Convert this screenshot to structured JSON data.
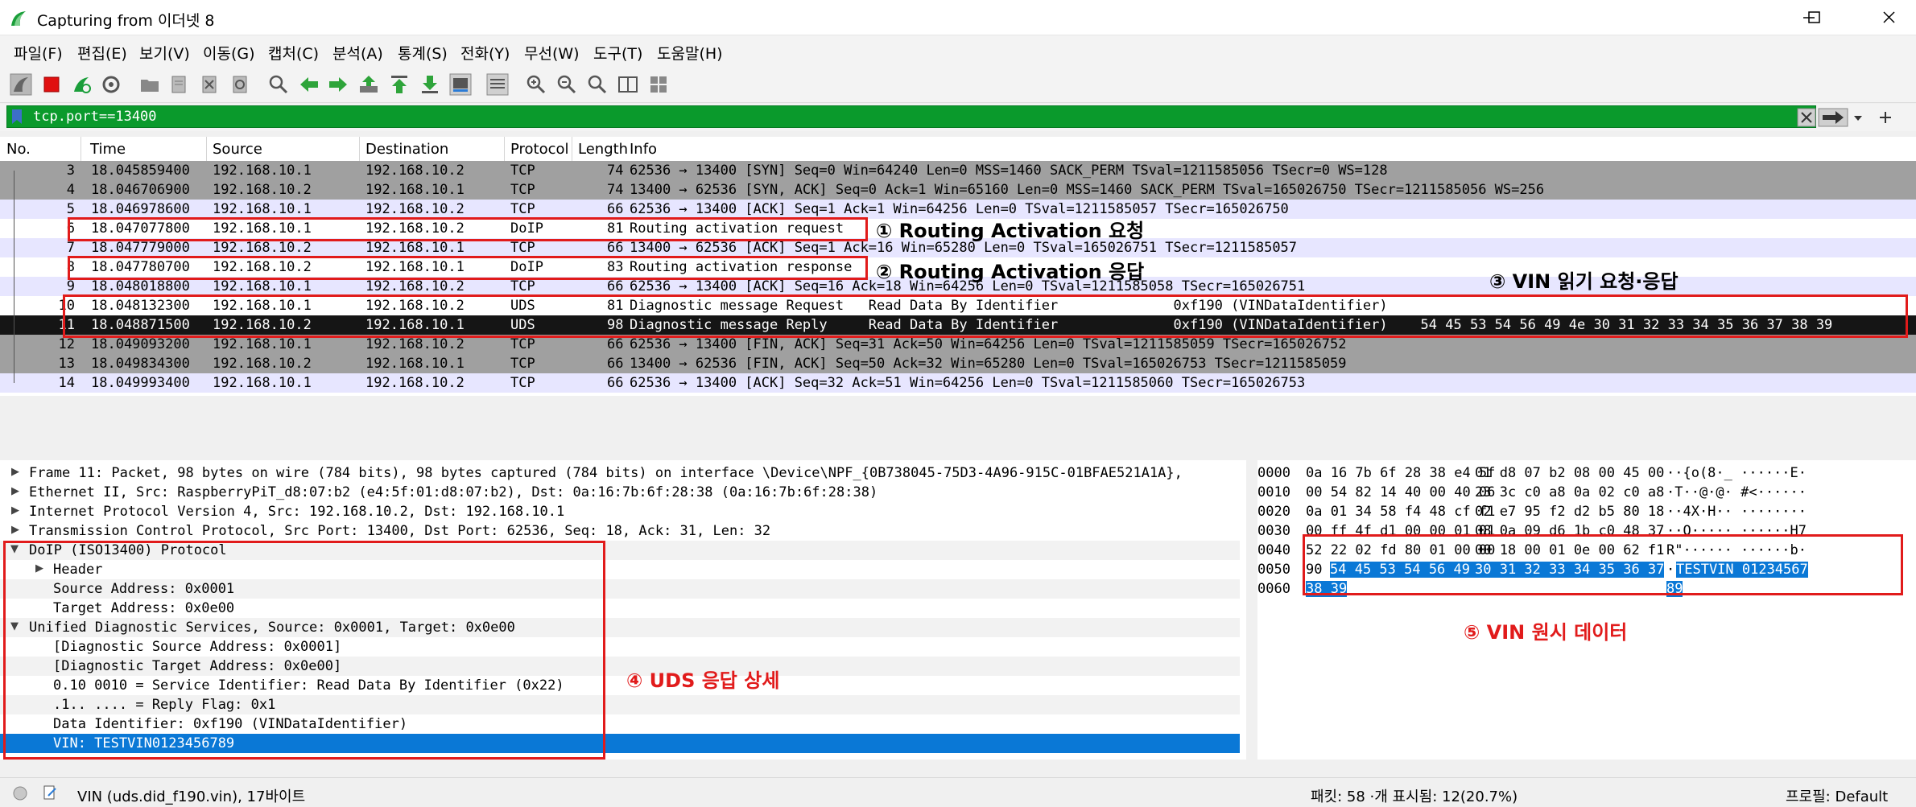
{
  "window": {
    "title": "Capturing from 이더넷 8"
  },
  "menu": [
    "파일(F)",
    "편집(E)",
    "보기(V)",
    "이동(G)",
    "캡처(C)",
    "분석(A)",
    "통계(S)",
    "전화(Y)",
    "무선(W)",
    "도구(T)",
    "도움말(H)"
  ],
  "filter": {
    "value": "tcp.port==13400"
  },
  "packet_list": {
    "columns": [
      "No.",
      "Time",
      "Source",
      "Destination",
      "Protocol",
      "Length",
      "Info"
    ],
    "rows": [
      {
        "no": "3",
        "time": "18.045859400",
        "src": "192.168.10.1",
        "dst": "192.168.10.2",
        "proto": "TCP",
        "len": "74",
        "info": "62536 → 13400 [SYN] Seq=0 Win=64240 Len=0 MSS=1460 SACK_PERM TSval=1211585056 TSecr=0 WS=128"
      },
      {
        "no": "4",
        "time": "18.046706900",
        "src": "192.168.10.2",
        "dst": "192.168.10.1",
        "proto": "TCP",
        "len": "74",
        "info": "13400 → 62536 [SYN, ACK] Seq=0 Ack=1 Win=65160 Len=0 MSS=1460 SACK_PERM TSval=165026750 TSecr=1211585056 WS=256"
      },
      {
        "no": "5",
        "time": "18.046978600",
        "src": "192.168.10.1",
        "dst": "192.168.10.2",
        "proto": "TCP",
        "len": "66",
        "info": "62536 → 13400 [ACK] Seq=1 Ack=1 Win=64256 Len=0 TSval=1211585057 TSecr=165026750"
      },
      {
        "no": "6",
        "time": "18.047077800",
        "src": "192.168.10.1",
        "dst": "192.168.10.2",
        "proto": "DoIP",
        "len": "81",
        "info": "Routing activation request"
      },
      {
        "no": "7",
        "time": "18.047779000",
        "src": "192.168.10.2",
        "dst": "192.168.10.1",
        "proto": "TCP",
        "len": "66",
        "info": "13400 → 62536 [ACK] Seq=1 Ack=16 Win=65280 Len=0 TSval=165026751 TSecr=1211585057"
      },
      {
        "no": "8",
        "time": "18.047780700",
        "src": "192.168.10.2",
        "dst": "192.168.10.1",
        "proto": "DoIP",
        "len": "83",
        "info": "Routing activation response"
      },
      {
        "no": "9",
        "time": "18.048018800",
        "src": "192.168.10.1",
        "dst": "192.168.10.2",
        "proto": "TCP",
        "len": "66",
        "info": "62536 → 13400 [ACK] Seq=16 Ack=18 Win=64256 Len=0 TSval=1211585058 TSecr=165026751"
      },
      {
        "no": "10",
        "time": "18.048132300",
        "src": "192.168.10.1",
        "dst": "192.168.10.2",
        "proto": "UDS",
        "len": "81",
        "info": "Diagnostic message Request   Read Data By Identifier              0xf190 (VINDataIdentifier)"
      },
      {
        "no": "11",
        "time": "18.048871500",
        "src": "192.168.10.2",
        "dst": "192.168.10.1",
        "proto": "UDS",
        "len": "98",
        "info": "Diagnostic message Reply     Read Data By Identifier              0xf190 (VINDataIdentifier)    54 45 53 54 56 49 4e 30 31 32 33 34 35 36 37 38 39"
      },
      {
        "no": "12",
        "time": "18.049093200",
        "src": "192.168.10.1",
        "dst": "192.168.10.2",
        "proto": "TCP",
        "len": "66",
        "info": "62536 → 13400 [FIN, ACK] Seq=31 Ack=50 Win=64256 Len=0 TSval=1211585059 TSecr=165026752"
      },
      {
        "no": "13",
        "time": "18.049834300",
        "src": "192.168.10.2",
        "dst": "192.168.10.1",
        "proto": "TCP",
        "len": "66",
        "info": "13400 → 62536 [FIN, ACK] Seq=50 Ack=32 Win=65280 Len=0 TSval=165026753 TSecr=1211585059"
      },
      {
        "no": "14",
        "time": "18.049993400",
        "src": "192.168.10.1",
        "dst": "192.168.10.2",
        "proto": "TCP",
        "len": "66",
        "info": "62536 → 13400 [ACK] Seq=32 Ack=51 Win=64256 Len=0 TSval=1211585060 TSecr=165026753"
      }
    ]
  },
  "details": [
    "Frame 11: Packet, 98 bytes on wire (784 bits), 98 bytes captured (784 bits) on interface \\Device\\NPF_{0B738045-75D3-4A96-915C-01BFAE521A1A},",
    "Ethernet II, Src: RaspberryPiT_d8:07:b2 (e4:5f:01:d8:07:b2), Dst: 0a:16:7b:6f:28:38 (0a:16:7b:6f:28:38)",
    "Internet Protocol Version 4, Src: 192.168.10.2, Dst: 192.168.10.1",
    "Transmission Control Protocol, Src Port: 13400, Dst Port: 62536, Seq: 18, Ack: 31, Len: 32",
    "DoIP (ISO13400) Protocol",
    "Header",
    "Source Address: 0x0001",
    "Target Address: 0x0e00",
    "Unified Diagnostic Services, Source: 0x0001, Target: 0x0e00",
    "[Diagnostic Source Address: 0x0001]",
    "[Diagnostic Target Address: 0x0e00]",
    "0.10 0010 = Service Identifier: Read Data By Identifier (0x22)",
    ".1.. .... = Reply Flag: 0x1",
    "Data Identifier: 0xf190 (VINDataIdentifier)",
    "VIN: TESTVIN0123456789"
  ],
  "bytes": [
    {
      "off": "0000",
      "hex1": "0a 16 7b 6f 28 38 e4 5f",
      "hex2": "01 d8 07 b2 08 00 45 00",
      "ascii": "··{o(8·_ ······E·"
    },
    {
      "off": "0010",
      "hex1": "00 54 82 14 40 00 40 06",
      "hex2": "23 3c c0 a8 0a 02 c0 a8",
      "ascii": "·T··@·@· #<······"
    },
    {
      "off": "0020",
      "hex1": "0a 01 34 58 f4 48 cf f1",
      "hex2": "02 e7 95 f2 d2 b5 80 18",
      "ascii": "··4X·H·· ········"
    },
    {
      "off": "0030",
      "hex1": "00 ff 4f d1 00 00 01 01",
      "hex2": "08 0a 09 d6 1b c0 48 37",
      "ascii": "··O····· ······H7"
    },
    {
      "off": "0040",
      "hex1": "52 22 02 fd 80 01 00 00",
      "hex2": "00 18 00 01 0e 00 62 f1",
      "ascii": "R\"······ ······b·"
    },
    {
      "off": "0050",
      "hex1a": "90 ",
      "hex1b": "54 45 53 54 56 49 4e",
      "hex2": "30 31 32 33 34 35 36 37",
      "asciia": "·",
      "asciib": "TESTVIN 01234567"
    },
    {
      "off": "0060",
      "hex1": "38 39",
      "ascii": "89"
    }
  ],
  "annotations": {
    "a1": "① Routing Activation 요청",
    "a2": "② Routing Activation 응답",
    "a3": "③ VIN 읽기 요청·응답",
    "a4": "④ UDS 응답 상세",
    "a5": "⑤ VIN 원시 데이터"
  },
  "status": {
    "field": "VIN (uds.did_f190.vin), 17바이트",
    "packets": "패킷: 58 ·개 표시됨: 12(20.7%)",
    "profile": "프로필: Default"
  }
}
